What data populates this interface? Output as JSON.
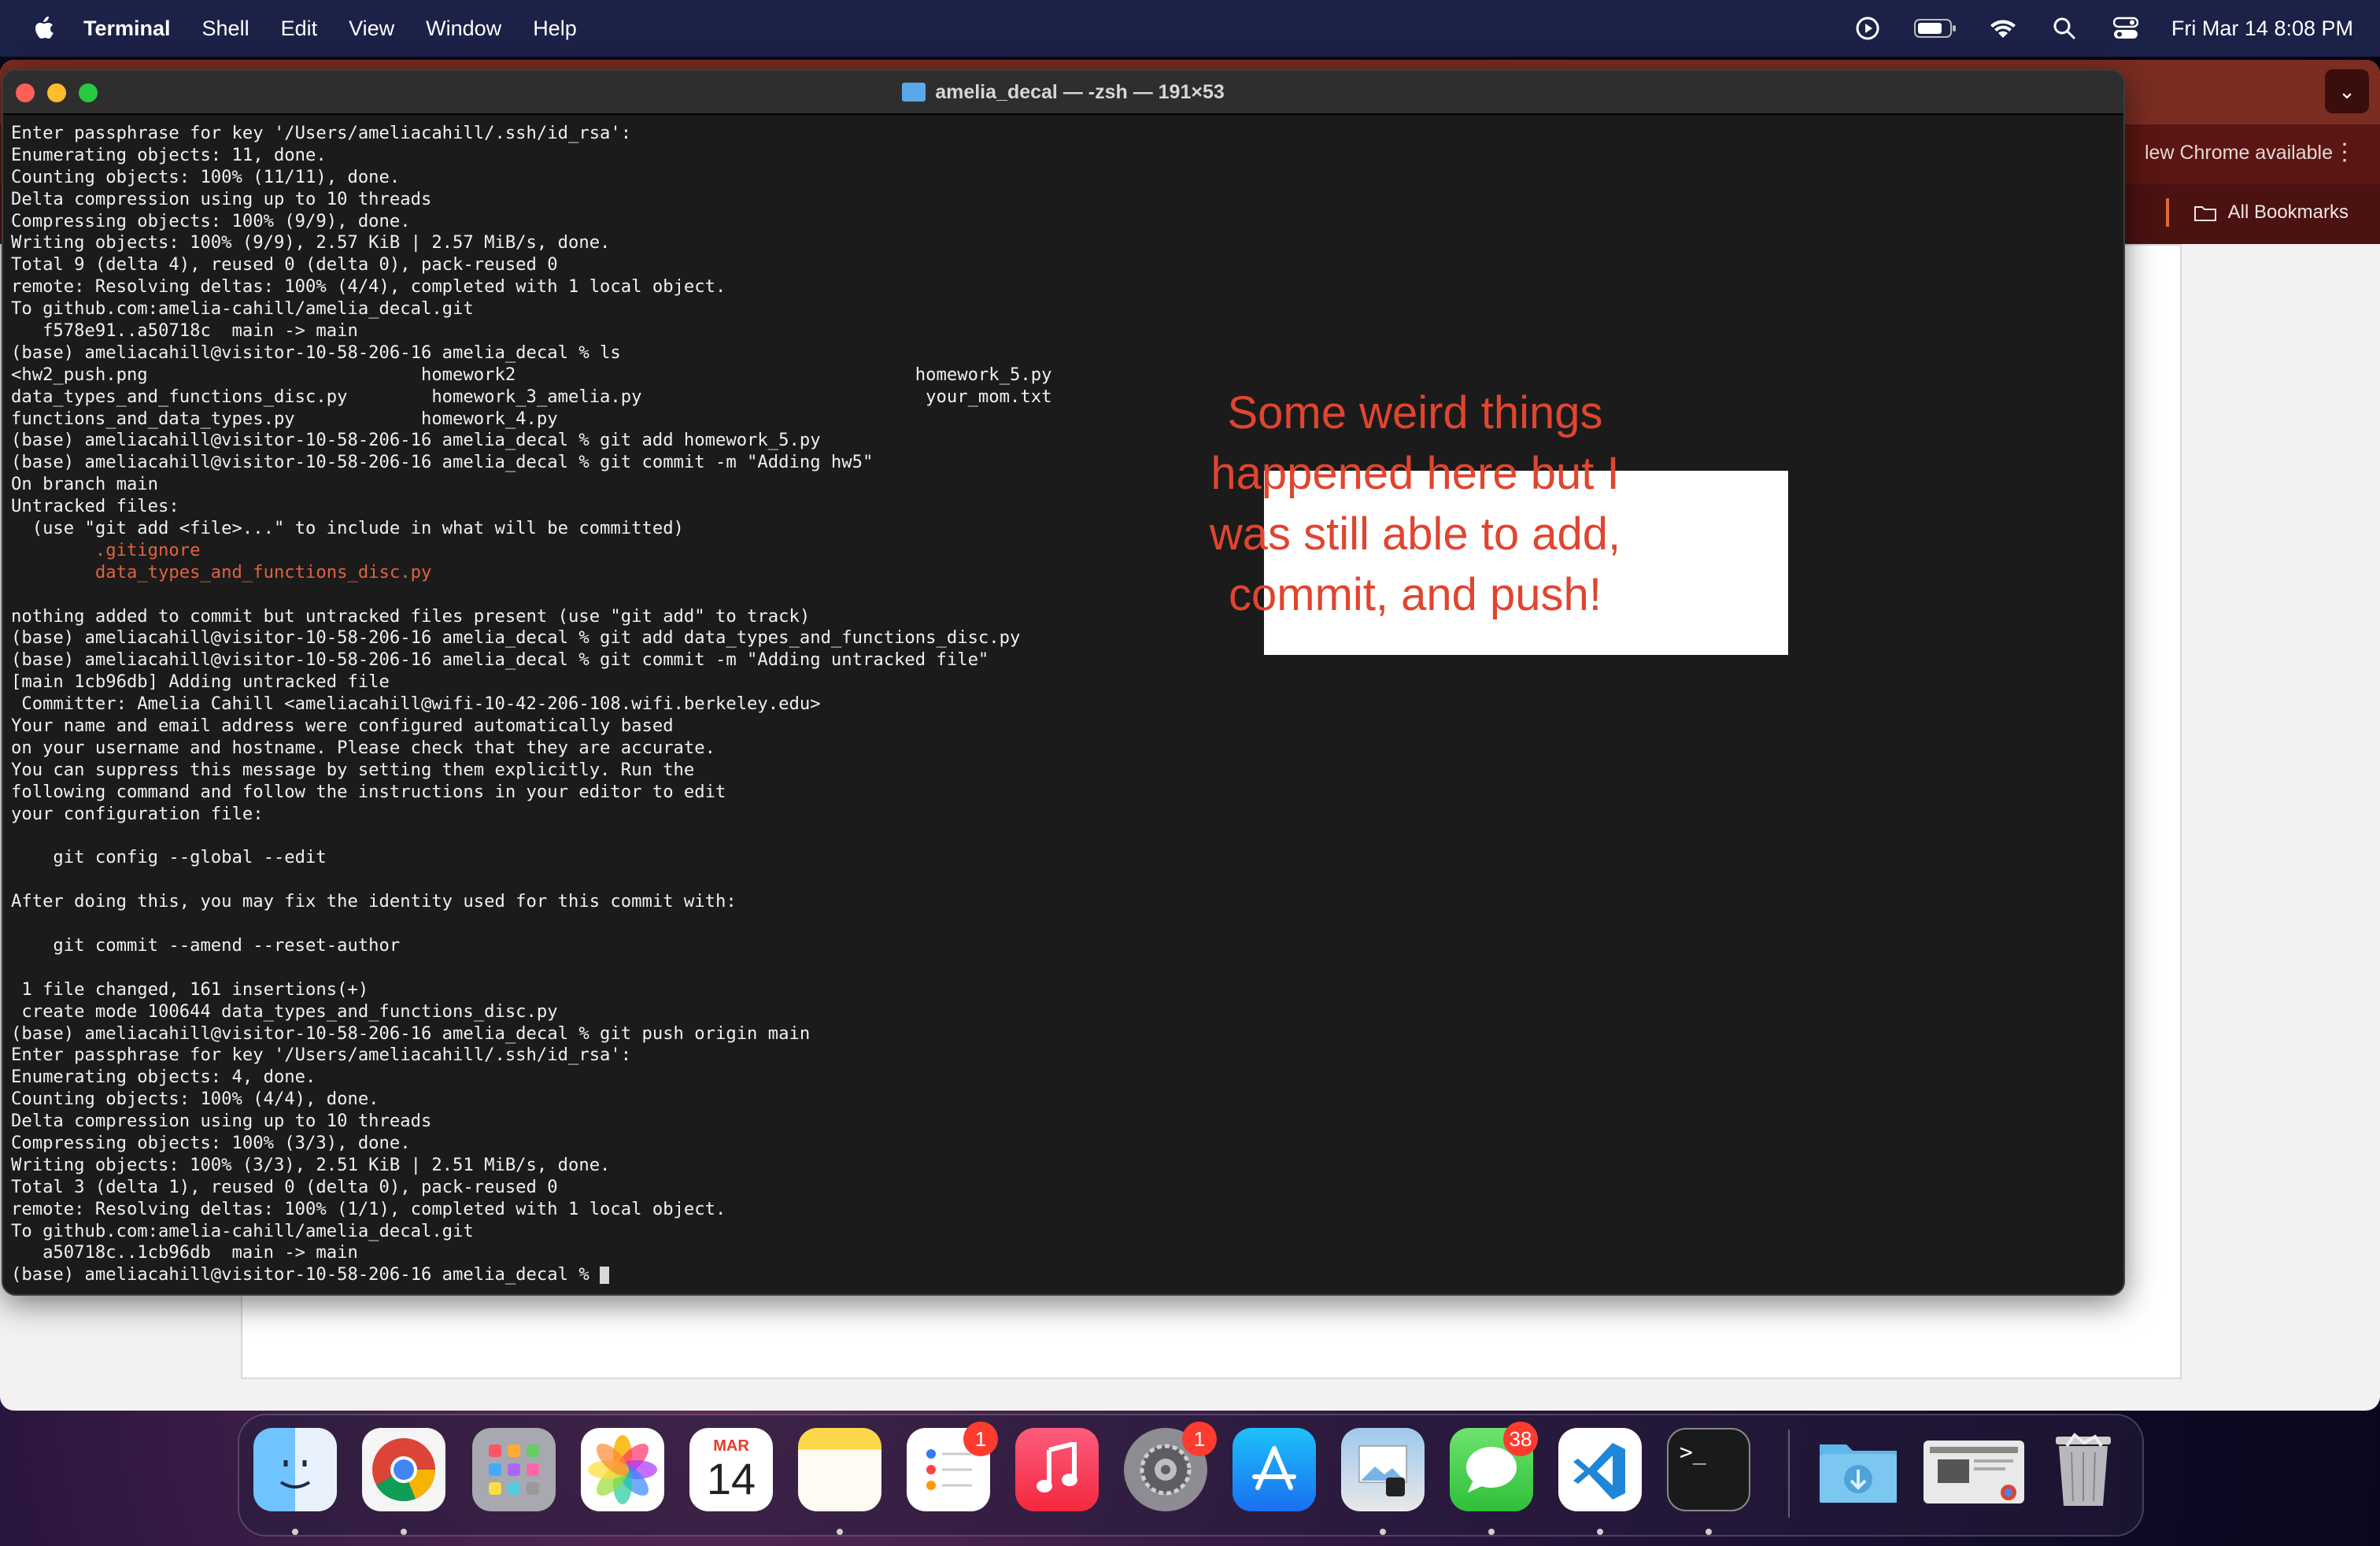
{
  "menubar": {
    "app": "Terminal",
    "items": [
      "Shell",
      "Edit",
      "View",
      "Window",
      "Help"
    ],
    "clock": "Fri Mar 14  8:08 PM"
  },
  "chrome": {
    "new_version": "lew Chrome available",
    "all_bookmarks": "All Bookmarks"
  },
  "terminal": {
    "title": "amelia_decal — -zsh — 191×53",
    "lines": [
      {
        "text": "Enter passphrase for key '/Users/ameliacahill/.ssh/id_rsa':"
      },
      {
        "text": "Enumerating objects: 11, done."
      },
      {
        "text": "Counting objects: 100% (11/11), done."
      },
      {
        "text": "Delta compression using up to 10 threads"
      },
      {
        "text": "Compressing objects: 100% (9/9), done."
      },
      {
        "text": "Writing objects: 100% (9/9), 2.57 KiB | 2.57 MiB/s, done."
      },
      {
        "text": "Total 9 (delta 4), reused 0 (delta 0), pack-reused 0"
      },
      {
        "text": "remote: Resolving deltas: 100% (4/4), completed with 1 local object."
      },
      {
        "text": "To github.com:amelia-cahill/amelia_decal.git"
      },
      {
        "text": "   f578e91..a50718c  main -> main"
      },
      {
        "text": "(base) ameliacahill@visitor-10-58-206-16 amelia_decal % ls"
      },
      {
        "text": "<hw2_push.png                          homework2                                      homework_5.py"
      },
      {
        "text": "data_types_and_functions_disc.py        homework_3_amelia.py                           your_mom.txt"
      },
      {
        "text": "functions_and_data_types.py            homework_4.py"
      },
      {
        "text": "(base) ameliacahill@visitor-10-58-206-16 amelia_decal % git add homework_5.py"
      },
      {
        "text": "(base) ameliacahill@visitor-10-58-206-16 amelia_decal % git commit -m \"Adding hw5\""
      },
      {
        "text": "On branch main"
      },
      {
        "text": "Untracked files:"
      },
      {
        "text": "  (use \"git add <file>...\" to include in what will be committed)"
      },
      {
        "text": "        .gitignore",
        "color": "orange"
      },
      {
        "text": "        data_types_and_functions_disc.py",
        "color": "orange"
      },
      {
        "text": ""
      },
      {
        "text": "nothing added to commit but untracked files present (use \"git add\" to track)"
      },
      {
        "text": "(base) ameliacahill@visitor-10-58-206-16 amelia_decal % git add data_types_and_functions_disc.py"
      },
      {
        "text": "(base) ameliacahill@visitor-10-58-206-16 amelia_decal % git commit -m \"Adding untracked file\""
      },
      {
        "text": "[main 1cb96db] Adding untracked file"
      },
      {
        "text": " Committer: Amelia Cahill <ameliacahill@wifi-10-42-206-108.wifi.berkeley.edu>"
      },
      {
        "text": "Your name and email address were configured automatically based"
      },
      {
        "text": "on your username and hostname. Please check that they are accurate."
      },
      {
        "text": "You can suppress this message by setting them explicitly. Run the"
      },
      {
        "text": "following command and follow the instructions in your editor to edit"
      },
      {
        "text": "your configuration file:"
      },
      {
        "text": ""
      },
      {
        "text": "    git config --global --edit"
      },
      {
        "text": ""
      },
      {
        "text": "After doing this, you may fix the identity used for this commit with:"
      },
      {
        "text": ""
      },
      {
        "text": "    git commit --amend --reset-author"
      },
      {
        "text": ""
      },
      {
        "text": " 1 file changed, 161 insertions(+)"
      },
      {
        "text": " create mode 100644 data_types_and_functions_disc.py"
      },
      {
        "text": "(base) ameliacahill@visitor-10-58-206-16 amelia_decal % git push origin main"
      },
      {
        "text": "Enter passphrase for key '/Users/ameliacahill/.ssh/id_rsa':"
      },
      {
        "text": "Enumerating objects: 4, done."
      },
      {
        "text": "Counting objects: 100% (4/4), done."
      },
      {
        "text": "Delta compression using up to 10 threads"
      },
      {
        "text": "Compressing objects: 100% (3/3), done."
      },
      {
        "text": "Writing objects: 100% (3/3), 2.51 KiB | 2.51 MiB/s, done."
      },
      {
        "text": "Total 3 (delta 1), reused 0 (delta 0), pack-reused 0"
      },
      {
        "text": "remote: Resolving deltas: 100% (1/1), completed with 1 local object."
      },
      {
        "text": "To github.com:amelia-cahill/amelia_decal.git"
      },
      {
        "text": "   a50718c..1cb96db  main -> main"
      }
    ],
    "prompt": "(base) ameliacahill@visitor-10-58-206-16 amelia_decal % "
  },
  "annotation": {
    "text": "Some weird things happened here but I was still able to add, commit, and push!",
    "color": "#e0452f"
  },
  "dock": {
    "calendar": {
      "month": "MAR",
      "day": "14"
    },
    "badges": {
      "reminders": "1",
      "settings": "1",
      "messages": "38"
    },
    "icons": [
      "finder-icon",
      "chrome-icon",
      "launchpad-icon",
      "photos-icon",
      "calendar-icon",
      "notes-icon",
      "reminders-icon",
      "music-icon",
      "system-settings-icon",
      "app-store-icon",
      "preview-icon",
      "messages-icon",
      "vscode-icon",
      "terminal-icon",
      "downloads-folder-icon",
      "chrome-window-thumbnail",
      "trash-icon"
    ]
  }
}
